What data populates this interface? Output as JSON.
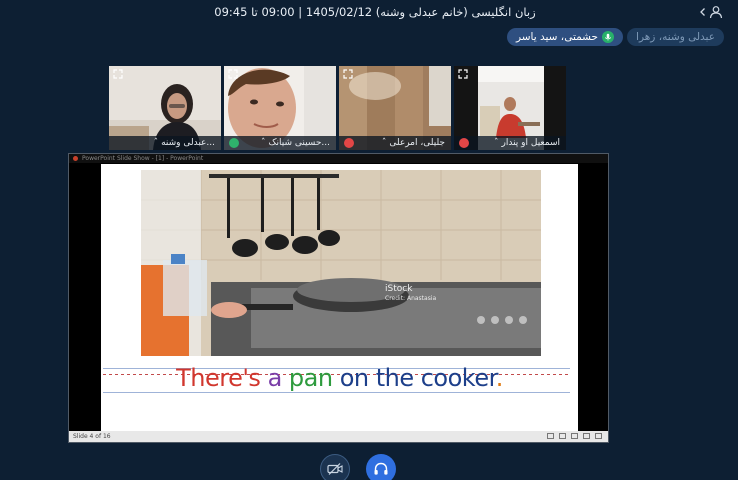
{
  "header": {
    "title": "زبان انگلیسی (خانم عبدلی وشنه) 1405/02/12 | 09:00 تا 09:45"
  },
  "speakers": [
    {
      "name": "عبدلی وشنه، زهرا",
      "state": "muted"
    },
    {
      "name": "حشمتی، سید یاسر",
      "state": "speaking"
    }
  ],
  "participants": [
    {
      "name": "عبدلی وشنه...",
      "audio": "none"
    },
    {
      "name": "حسینی شیانک...",
      "audio": "on"
    },
    {
      "name": "جلیلی، امرعلی",
      "audio": "off"
    },
    {
      "name": "اسمعیل او پندار",
      "audio": "off"
    }
  ],
  "screen_share": {
    "window_title": "PowerPoint Slide Show - [1] - PowerPoint",
    "photo_watermark": "iStock",
    "photo_credit": "Credit: Anastasia",
    "caption_parts": [
      {
        "text": "There's",
        "color": "#d1372e"
      },
      {
        "text": " a",
        "color": "#7a3ea8"
      },
      {
        "text": " pan",
        "color": "#2e9b3e"
      },
      {
        "text": " on the cooker",
        "color": "#1d3f8a"
      },
      {
        "text": ".",
        "color": "#e07a10"
      }
    ],
    "status_text": "Slide 4 of 16"
  },
  "controls": {
    "camera_icon": "camera-off-icon",
    "audio_icon": "headphones-icon"
  }
}
